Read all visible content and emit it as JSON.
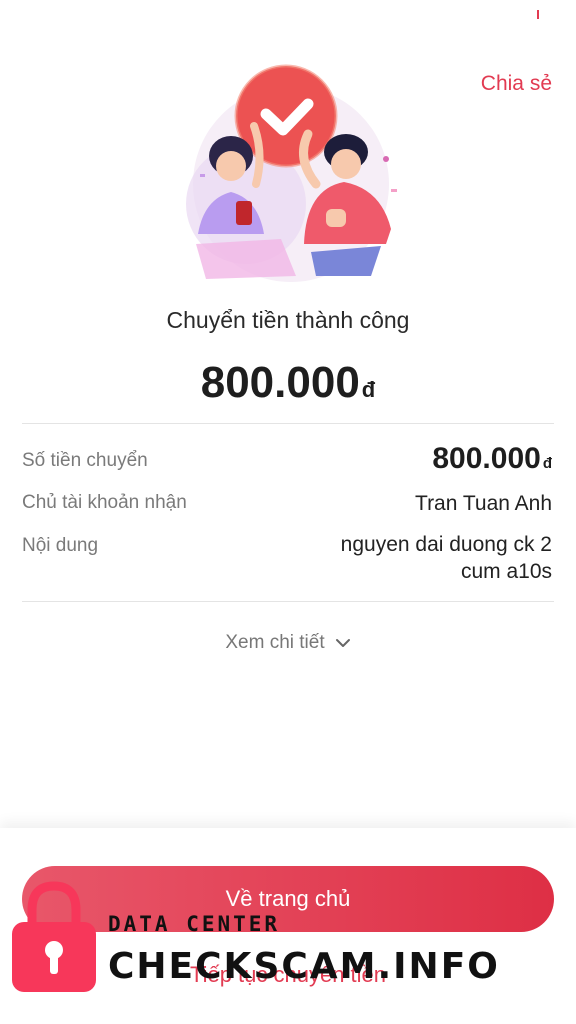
{
  "header": {
    "share_label": "Chia sẻ"
  },
  "result": {
    "status_text": "Chuyển tiền thành công",
    "amount": "800.000",
    "currency": "đ"
  },
  "details": {
    "amount_label": "Số tiền chuyển",
    "amount_value": "800.000",
    "amount_currency": "đ",
    "recipient_label": "Chủ tài khoản nhận",
    "recipient_value": "Tran Tuan Anh",
    "content_label": "Nội dung",
    "content_value": "nguyen dai duong ck 2 cum a10s"
  },
  "view_details": {
    "label": "Xem chi tiết",
    "icon": "chevron-down-icon"
  },
  "actions": {
    "home_label": "Về trang chủ",
    "continue_label": "Tiếp tục chuyển tiền"
  },
  "watermark": {
    "line1": "DATA CENTER",
    "line2": "CHECKSCAM.INFO",
    "icon": "lock-icon"
  },
  "colors": {
    "accent": "#e23b52",
    "button_start": "#e8576a",
    "button_end": "#de2f45"
  }
}
